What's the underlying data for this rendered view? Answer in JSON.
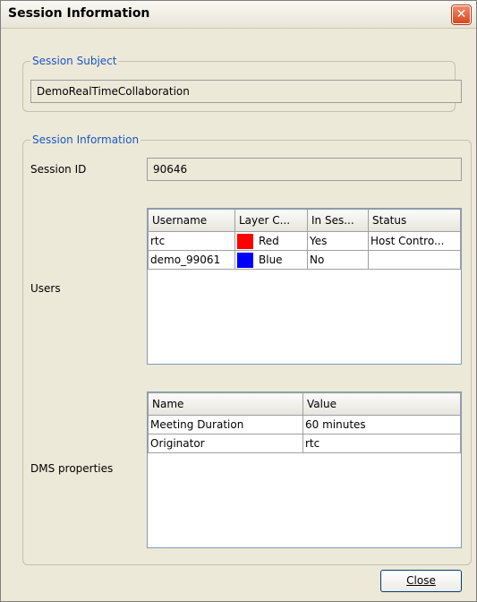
{
  "window": {
    "title": "Session Information",
    "close_glyph": "✕"
  },
  "subject_group": {
    "legend": "Session Subject",
    "value": "DemoRealTimeCollaboration"
  },
  "info_group": {
    "legend": "Session Information"
  },
  "session_id": {
    "label": "Session ID",
    "value": "90646"
  },
  "users": {
    "label": "Users",
    "columns": [
      "Username",
      "Layer C...",
      "In Ses...",
      "Status"
    ],
    "rows": [
      {
        "username": "rtc",
        "layer_color": "Red",
        "swatch": "#ff0000",
        "in_session": "Yes",
        "status": "Host Contro..."
      },
      {
        "username": "demo_99061",
        "layer_color": "Blue",
        "swatch": "#0000ff",
        "in_session": "No",
        "status": ""
      }
    ]
  },
  "dms": {
    "label": "DMS properties",
    "columns": [
      "Name",
      "Value"
    ],
    "rows": [
      {
        "name": "Meeting Duration",
        "value": "60 minutes"
      },
      {
        "name": "Originator",
        "value": "rtc"
      }
    ]
  },
  "buttons": {
    "close": "Close"
  },
  "colors": {
    "legend": "#1c55c4",
    "window_bg": "#ece9d8",
    "close_button_red": "#d9461f"
  }
}
